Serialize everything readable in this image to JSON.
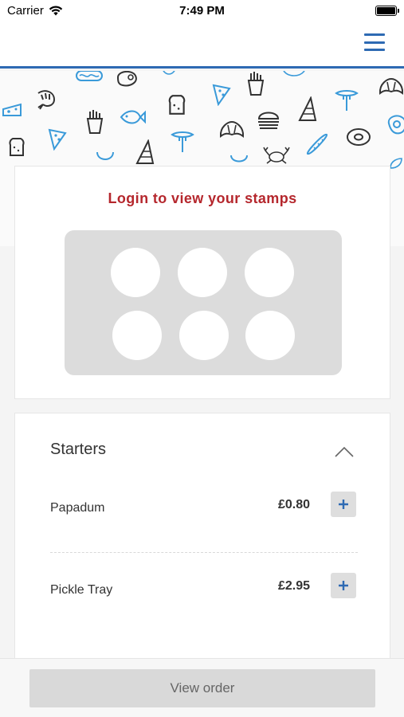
{
  "status_bar": {
    "carrier": "Carrier",
    "time": "7:49 PM"
  },
  "nav": {
    "menu_icon": "hamburger-menu-icon"
  },
  "banner": {
    "pattern": "food-doodle-pattern",
    "colors": {
      "dark": "#333333",
      "blue": "#3a9ad9"
    }
  },
  "stamps": {
    "title": "Login to view your stamps",
    "stamp_count": 6,
    "title_color": "#b5272d"
  },
  "menu": {
    "section_title": "Starters",
    "toggle_icon": "chevron-up-icon",
    "items": [
      {
        "name": "Papadum",
        "price": "£0.80",
        "add_icon": "plus-icon"
      },
      {
        "name": "Pickle Tray",
        "price": "£2.95",
        "add_icon": "plus-icon"
      }
    ]
  },
  "footer": {
    "view_order_label": "View order"
  },
  "colors": {
    "accent": "#2e6ab3",
    "stamp_panel": "#dcdcdc"
  }
}
